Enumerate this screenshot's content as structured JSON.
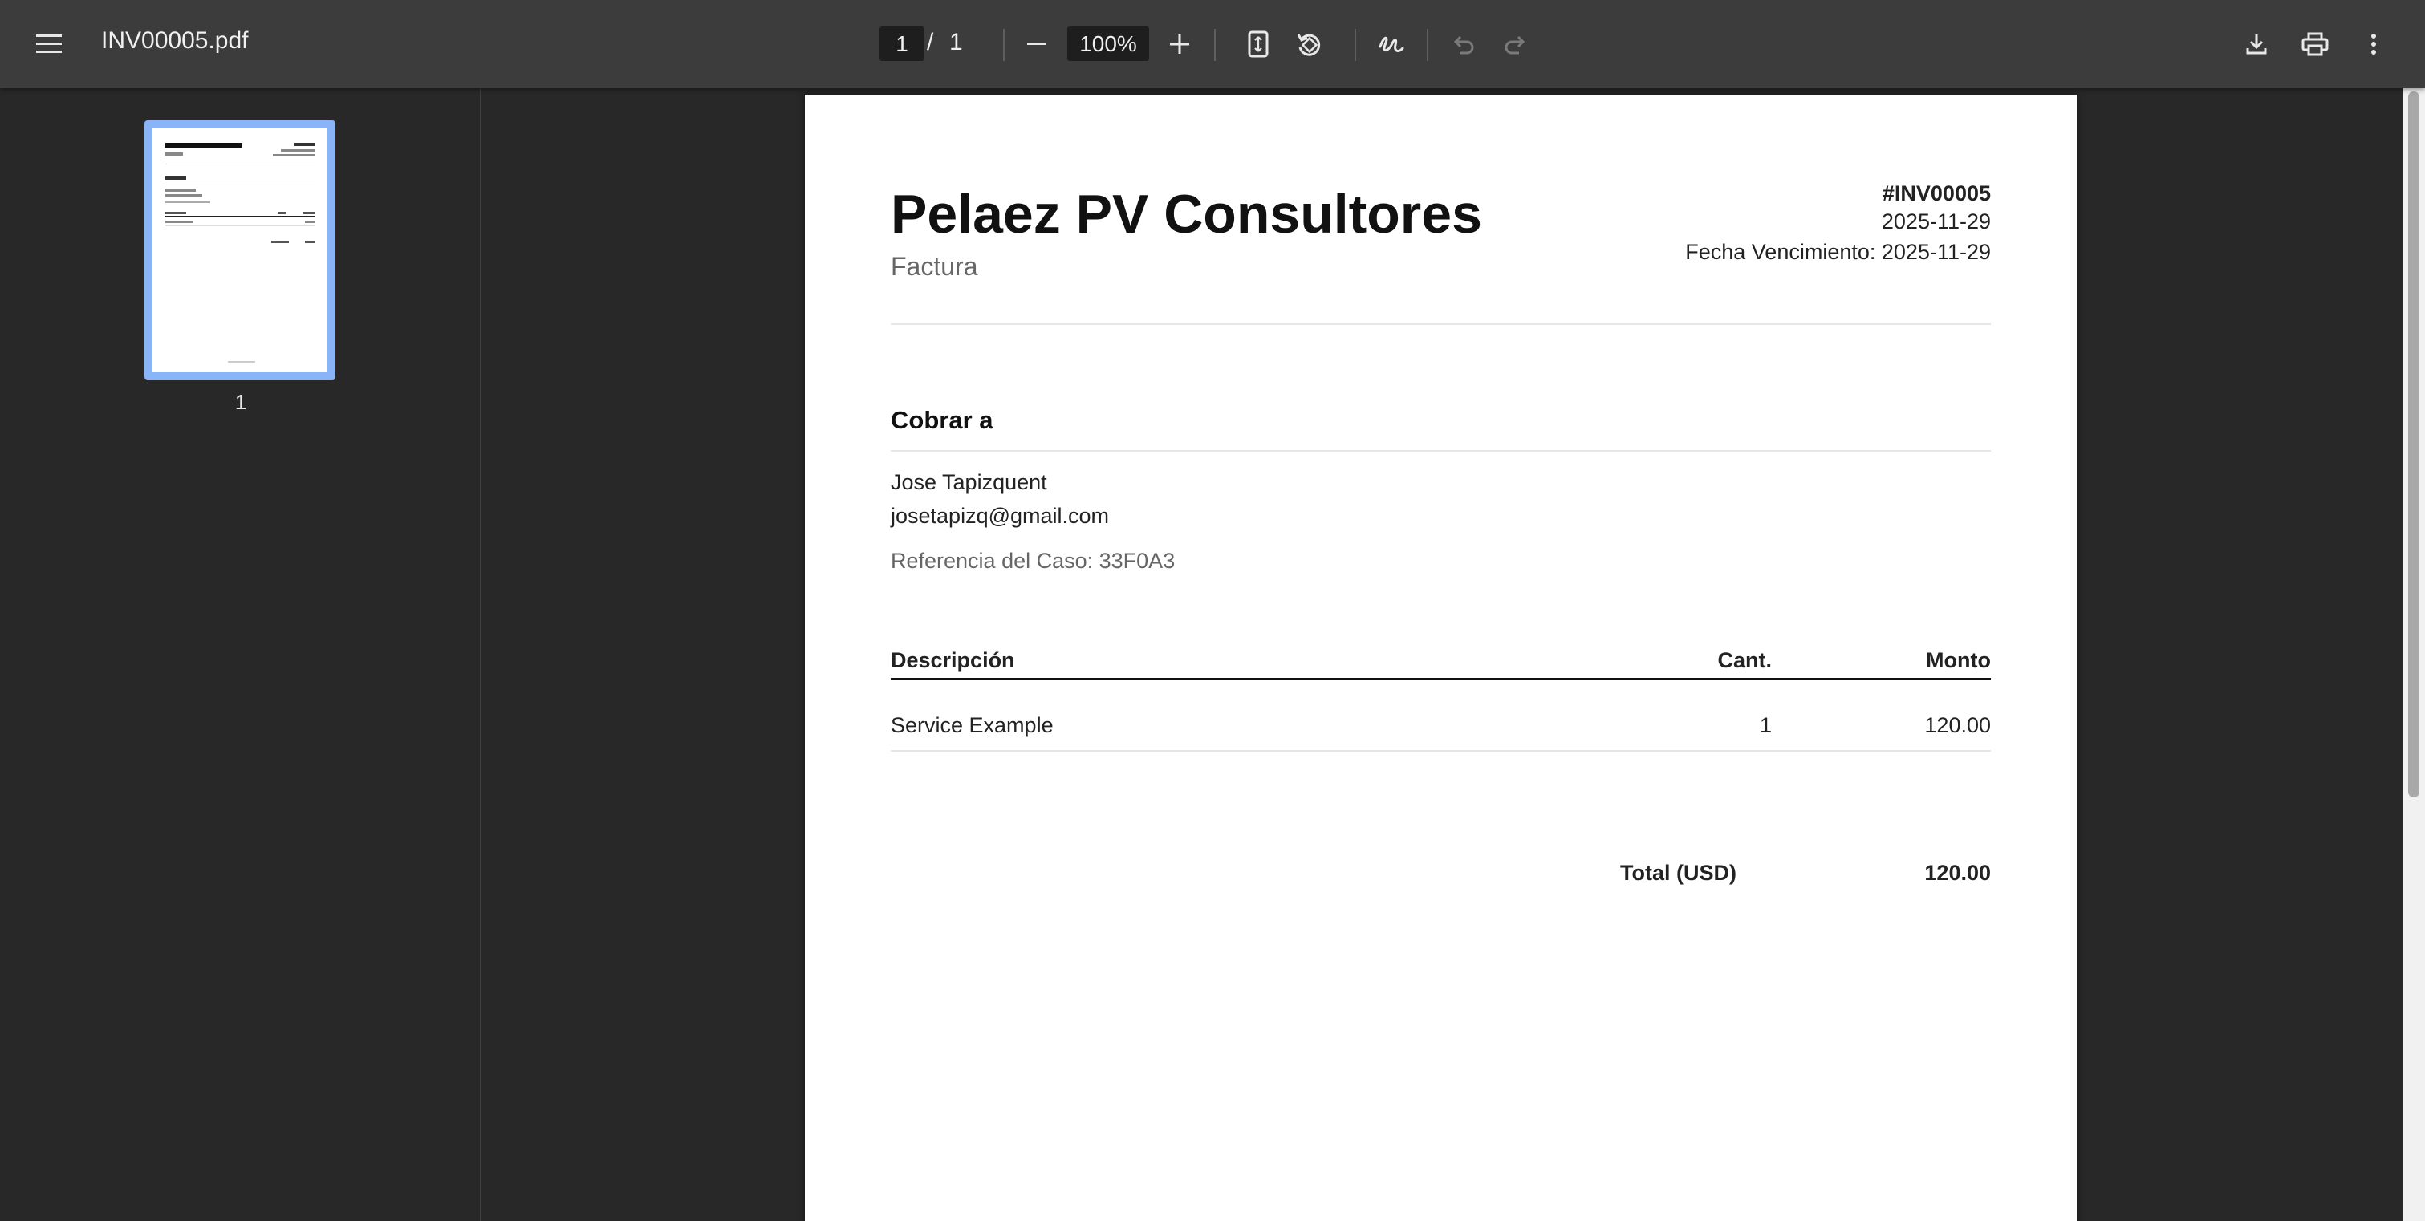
{
  "toolbar": {
    "file_name": "INV00005.pdf",
    "page_current": "1",
    "page_separator": "/",
    "page_total": "1",
    "zoom": "100%"
  },
  "sidebar": {
    "thumbnails": [
      {
        "label": "1"
      }
    ]
  },
  "invoice": {
    "company": "Pelaez PV Consultores",
    "doc_type": "Factura",
    "number": "#INV00005",
    "date": "2025-11-29",
    "due_date": "Fecha Vencimiento: 2025-11-29",
    "bill_to_heading": "Cobrar a",
    "client_name": "Jose Tapizquent",
    "client_email": "josetapizq@gmail.com",
    "case_reference": "Referencia del Caso: 33F0A3",
    "table": {
      "headers": [
        "Descripción",
        "Cant.",
        "Monto"
      ],
      "rows": [
        {
          "description": "Service Example",
          "quantity": "1",
          "amount": "120.00"
        }
      ]
    },
    "total_label": "Total (USD)",
    "total_value": "120.00"
  },
  "colors": {
    "toolbar_bg": "#3c3c3c",
    "viewer_bg": "#282828",
    "thumbnail_highlight": "#8ab4f8"
  },
  "icons": [
    "menu-icon",
    "zoom-out-icon",
    "zoom-in-icon",
    "fit-page-icon",
    "rotate-icon",
    "annotate-icon",
    "undo-icon",
    "redo-icon",
    "download-icon",
    "print-icon",
    "more-vert-icon"
  ]
}
